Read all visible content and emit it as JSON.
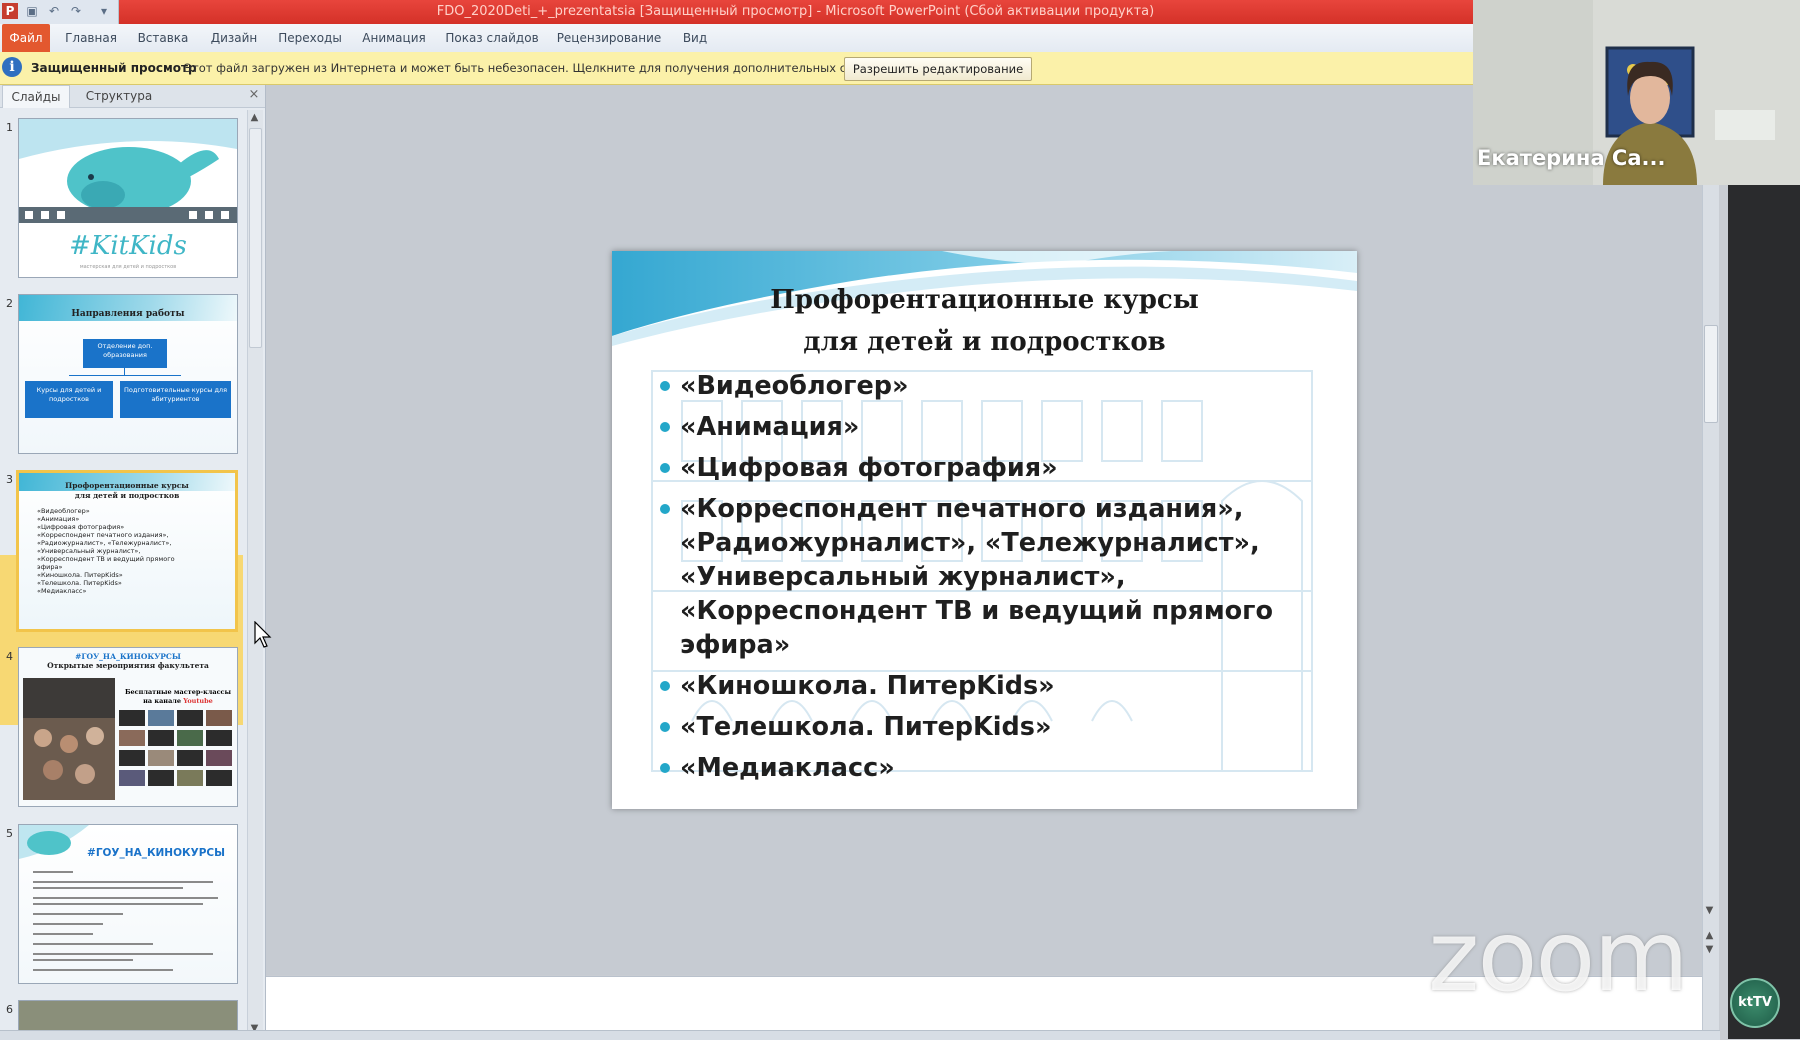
{
  "window": {
    "title": "FDO_2020Deti_+_prezentatsia [Защищенный просмотр] - Microsoft PowerPoint (Сбой активации продукта)"
  },
  "ribbon": {
    "tabs": [
      "Файл",
      "Главная",
      "Вставка",
      "Дизайн",
      "Переходы",
      "Анимация",
      "Показ слайдов",
      "Рецензирование",
      "Вид"
    ]
  },
  "protected_view": {
    "title": "Защищенный просмотр",
    "message": "Этот файл загружен из Интернета и может быть небезопасен. Щелкните для получения дополнительных сведений.",
    "button": "Разрешить редактирование"
  },
  "left_panel": {
    "tabs": [
      "Слайды",
      "Структура"
    ],
    "close": "×",
    "selected": 3,
    "thumbnails": [
      {
        "num": "1",
        "title": "#KitKids",
        "subtitle": "мастерская для детей и подростков"
      },
      {
        "num": "2",
        "title": "Направления работы",
        "boxes": [
          "Отделение доп. образования",
          "Курсы для детей и подростков",
          "Подготовительные курсы для абитуриентов"
        ]
      },
      {
        "num": "3",
        "title_lines": [
          "Профорентационные курсы",
          "для детей и подростков"
        ],
        "lines": [
          "«Видеоблогер»",
          "«Анимация»",
          "«Цифровая фотография»",
          "«Корреспондент печатного издания»,",
          "«Радиожурналист», «Тележурналист»,",
          "«Универсальный журналист»,",
          "«Корреспондент ТВ и ведущий прямого",
          "эфира»",
          "«Киношкола. ПитерKids»",
          "«Телешкола. ПитерKids»",
          "«Медиакласс»"
        ]
      },
      {
        "num": "4",
        "title_lines": [
          "#ГОУ_НА_КИНОКУРСЫ",
          "Открытые мероприятия факультета"
        ],
        "side": [
          "Бесплатные мастер-классы",
          "на канале"
        ],
        "highlight": "Youtube"
      },
      {
        "num": "5",
        "title": "#ГОУ_НА_КИНОКУРСЫ"
      },
      {
        "num": "6"
      }
    ]
  },
  "slide": {
    "title_lines": [
      "Профорентационные курсы",
      "для детей и подростков"
    ],
    "items": [
      "«Видеоблогер»",
      "«Анимация»",
      "«Цифровая фотография»",
      "«Корреспондент печатного издания», «Радиожурналист», «Тележурналист», «Универсальный журналист», «Корреспондент ТВ и ведущий прямого эфира»",
      "«Киношкола. ПитерKids»",
      "«Телешкола. ПитерKids»",
      "«Медиакласс»"
    ],
    "accent": "#23a7c9"
  },
  "zoom": {
    "participant_name": "Екатерина Са...",
    "watermark": "zoom",
    "tv_logo": "ktTV"
  }
}
